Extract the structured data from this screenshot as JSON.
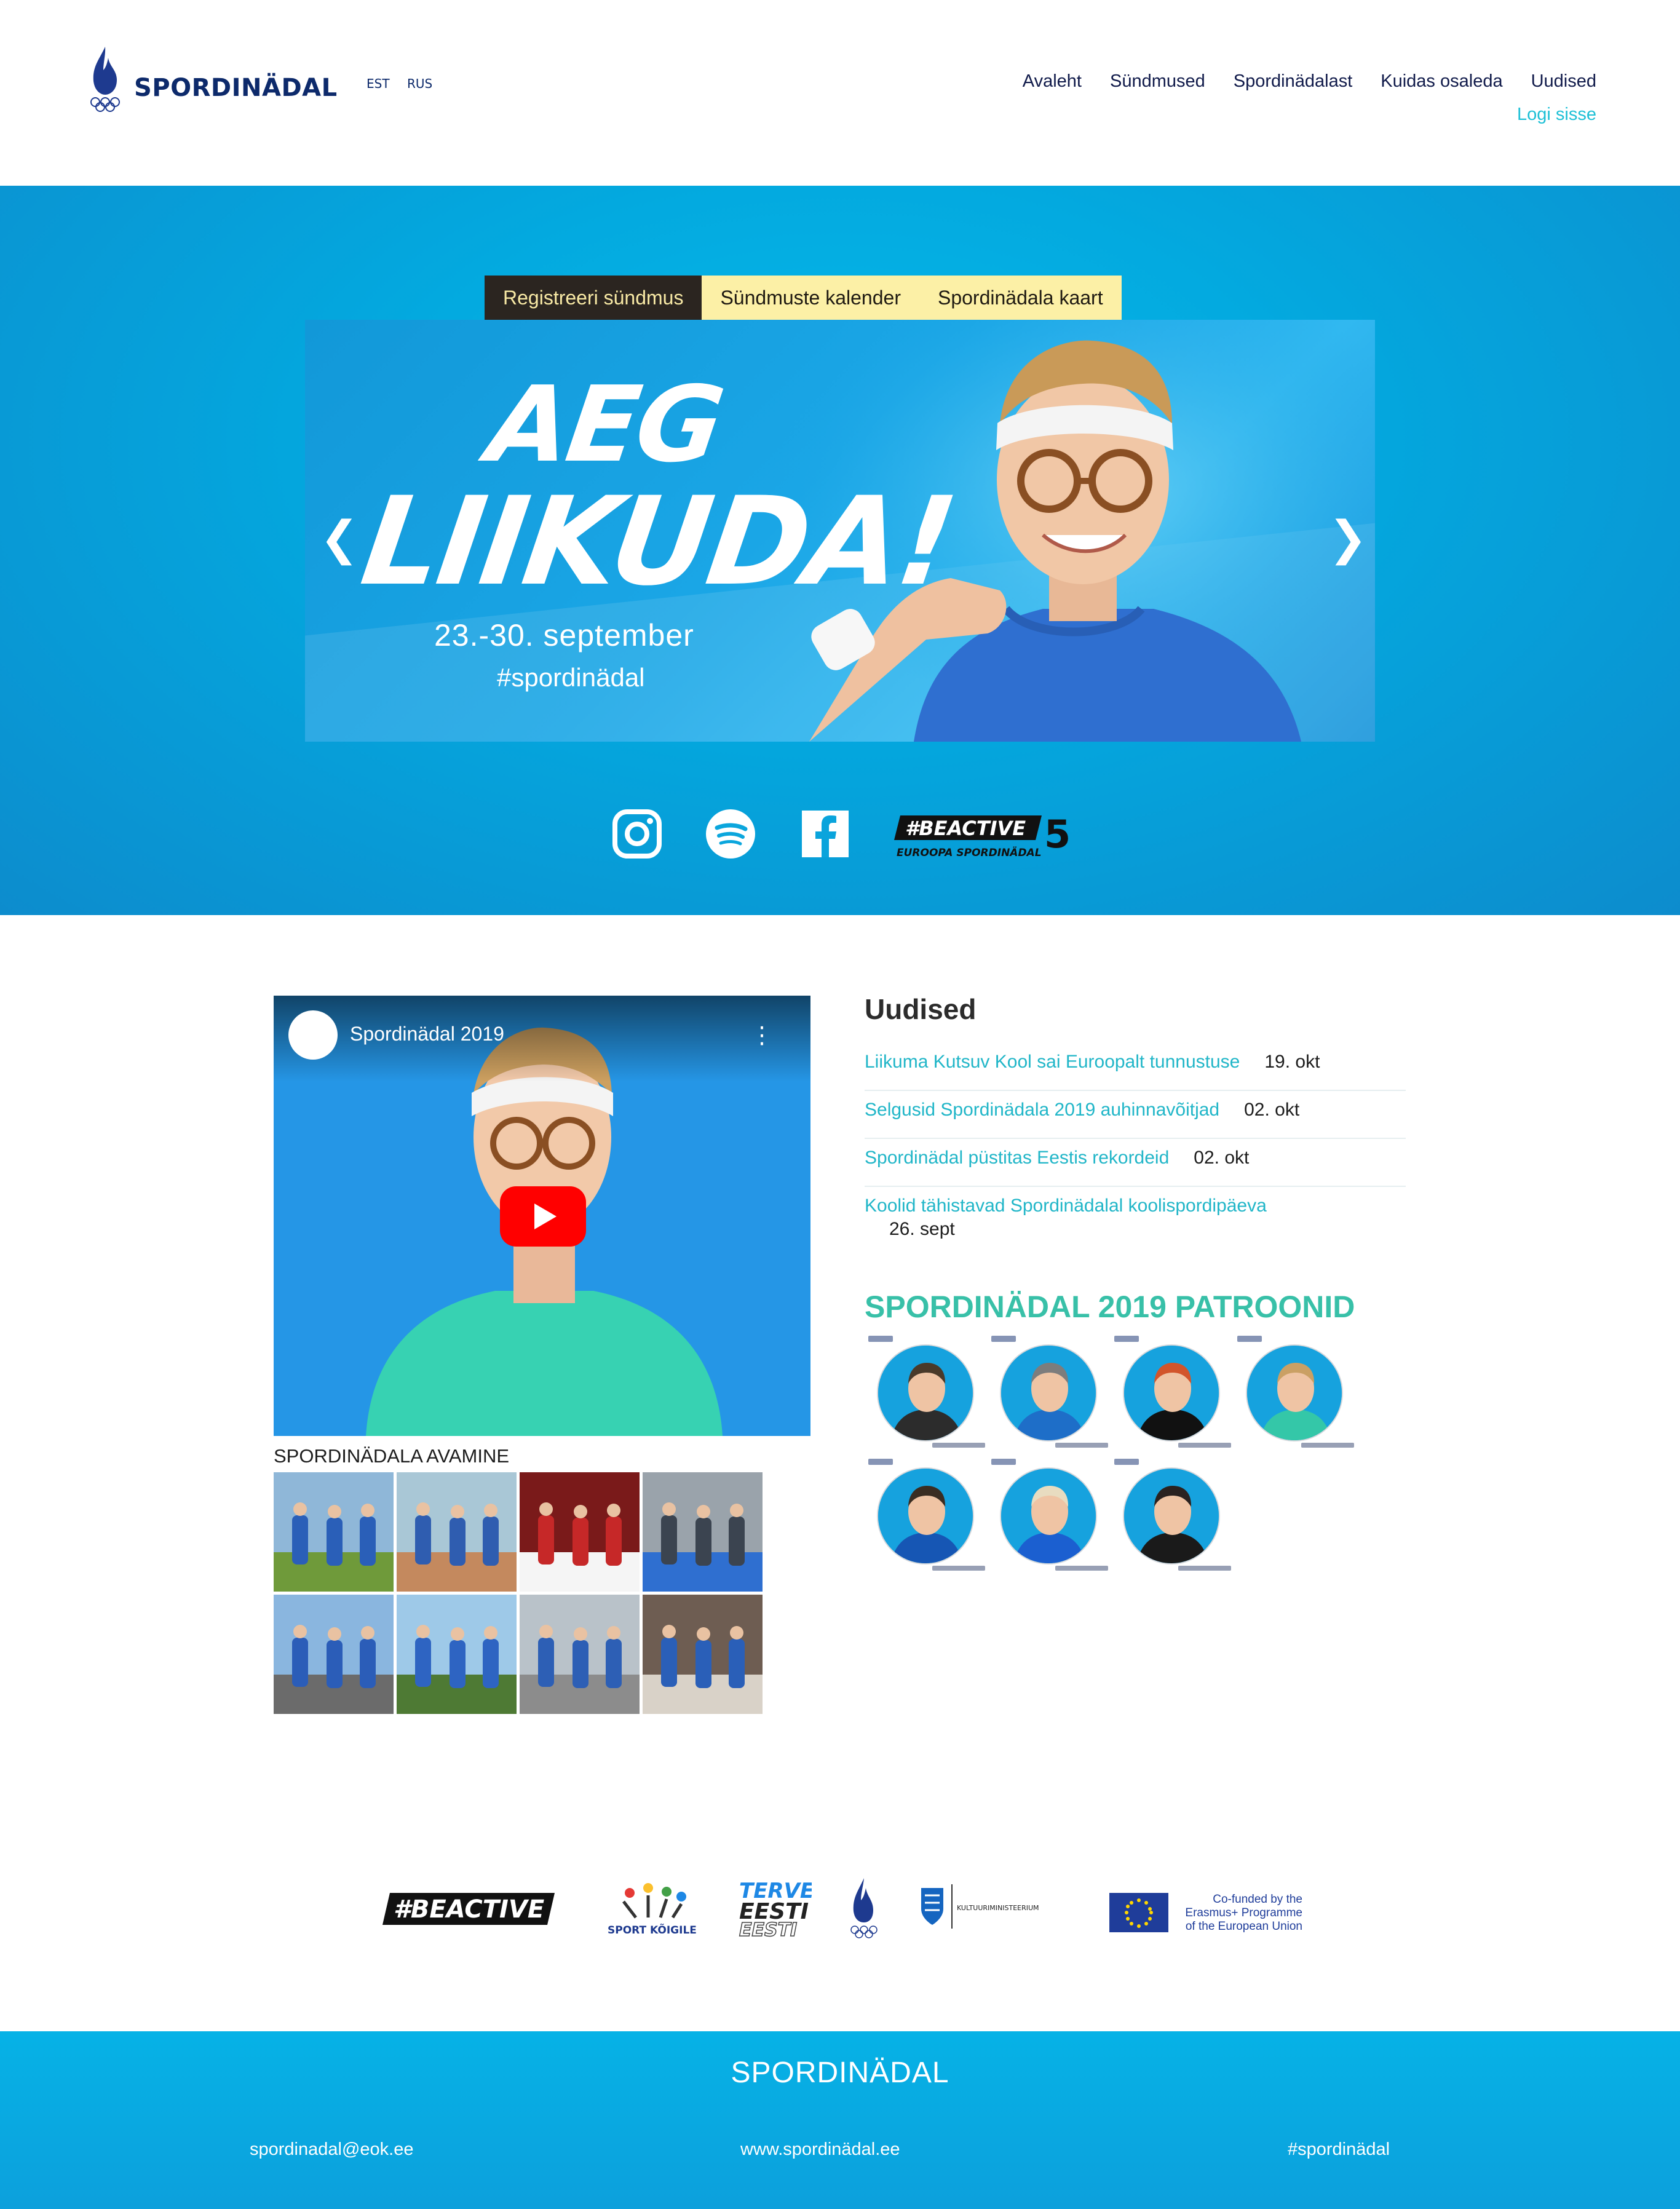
{
  "header": {
    "logo_text": "SPORDINÄDAL",
    "languages": [
      "EST",
      "RUS"
    ],
    "nav": [
      "Avaleht",
      "Sündmused",
      "Spordinädalast",
      "Kuidas osaleda",
      "Uudised"
    ],
    "login": "Logi sisse"
  },
  "hero": {
    "tabs": [
      "Registreeri sündmus",
      "Sündmuste kalender",
      "Spordinädala kaart"
    ],
    "headline_line1": "AEG",
    "headline_line2": "LIIKUDA!",
    "dates": "23.-30. september",
    "hashtag": "#spordinädal",
    "prev_arrow": "❮",
    "next_arrow": "❯",
    "social_icons": [
      "instagram-icon",
      "spotify-icon",
      "facebook-icon"
    ],
    "beactive_text": "#BEACTIVE",
    "beactive_sub": "EUROOPA SPORDINÄDAL"
  },
  "video": {
    "title": "Spordinädal 2019",
    "menu": "⋮"
  },
  "gallery": {
    "title": "SPORDINÄDALA AVAMINE",
    "count": 8
  },
  "news": {
    "title": "Uudised",
    "items": [
      {
        "title": "Liikuma Kutsuv Kool sai Euroopalt tunnustuse",
        "date": "19. okt"
      },
      {
        "title": "Selgusid Spordinädala 2019 auhinnavõitjad",
        "date": "02. okt"
      },
      {
        "title": "Spordinädal püstitas Eestis rekordeid",
        "date": "02. okt"
      },
      {
        "title": "Koolid tähistavad Spordinädalal koolispordipäeva",
        "date": "26. sept"
      }
    ]
  },
  "patrons": {
    "title": "SPORDINÄDAL 2019 PATROONID",
    "count": 7
  },
  "sponsors": {
    "beactive": "#BEACTIVE",
    "sport_koigile": "SPORT KÕIGILE",
    "terve_eesti": "TERVE EESTI",
    "kultuur": "KULTUURIMINISTEERIUM",
    "eu_line1": "Co-funded by the",
    "eu_line2": "Erasmus+ Programme",
    "eu_line3": "of the European Union"
  },
  "footer": {
    "title": "SPORDINÄDAL",
    "email": "spordinadal@eok.ee",
    "website": "www.spordinädal.ee",
    "hashtag": "#spordinädal"
  },
  "colors": {
    "hero_blue": "#03a9df",
    "tab_dark": "#2b2520",
    "tab_light": "#fcf0a6",
    "link_teal": "#21b6c8",
    "patron_green": "#38c0a8",
    "nav_navy": "#101a4a"
  }
}
